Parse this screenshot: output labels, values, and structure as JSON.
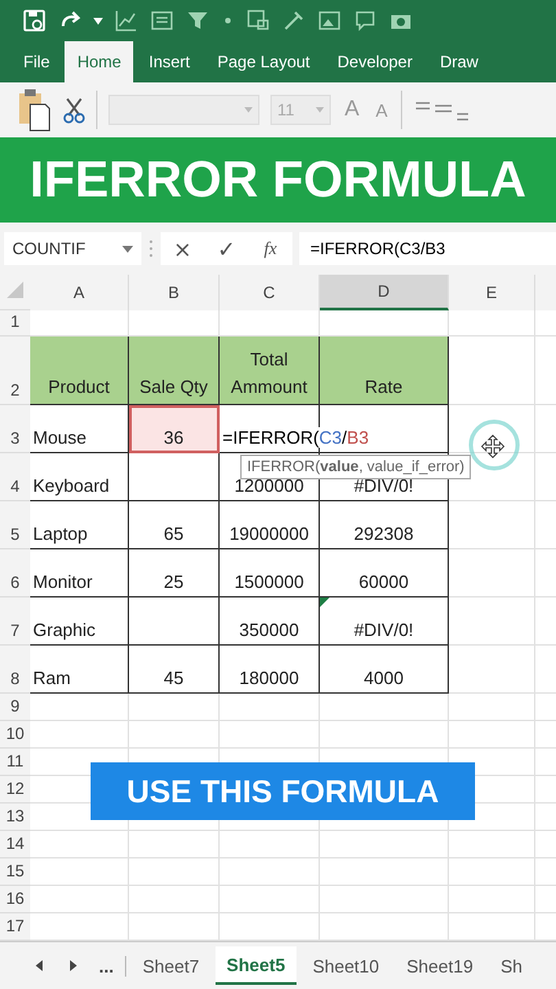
{
  "ribbon_tabs": [
    {
      "label": "File",
      "selected": false
    },
    {
      "label": "Home",
      "selected": true
    },
    {
      "label": "Insert",
      "selected": false
    },
    {
      "label": "Page Layout",
      "selected": false
    },
    {
      "label": "Developer",
      "selected": false
    },
    {
      "label": "Draw",
      "selected": false
    }
  ],
  "ribbon": {
    "font_size": "11",
    "grow_font": "A",
    "shrink_font": "A"
  },
  "banner": {
    "title": "IFERROR FORMULA"
  },
  "formula_bar": {
    "name_box": "COUNTIF",
    "cancel": "×",
    "enter": "✓",
    "function": "fx",
    "formula": "=IFERROR(C3/B3"
  },
  "columns": [
    {
      "label": "A",
      "selected": false
    },
    {
      "label": "B",
      "selected": false
    },
    {
      "label": "C",
      "selected": false
    },
    {
      "label": "D",
      "selected": true
    },
    {
      "label": "E",
      "selected": false
    }
  ],
  "row_numbers": [
    "1",
    "2",
    "3",
    "4",
    "5",
    "6",
    "7",
    "8",
    "9",
    "10",
    "11",
    "12",
    "13",
    "14",
    "15",
    "16",
    "17"
  ],
  "table": {
    "header": [
      "Product",
      "Sale Qty",
      "Total Ammount",
      "Rate"
    ],
    "rows": [
      {
        "product": "Mouse",
        "qty": "36",
        "qty_referenced": true,
        "error_flag": false,
        "formula_parts": [
          {
            "text": "=IFERROR(",
            "color": "#000000"
          },
          {
            "text": "C3",
            "color": "#4472c4"
          },
          {
            "text": "/",
            "color": "#000000"
          },
          {
            "text": "B3",
            "color": "#c0504d"
          }
        ]
      },
      {
        "product": "Keyboard",
        "qty_referenced": false,
        "error_flag": false,
        "total": "1200000",
        "rate": "#DIV/0!"
      },
      {
        "product": "Laptop",
        "qty": "65",
        "qty_referenced": false,
        "error_flag": false,
        "total": "19000000",
        "rate": "292308"
      },
      {
        "product": "Monitor",
        "qty": "25",
        "qty_referenced": false,
        "error_flag": false,
        "total": "1500000",
        "rate": "60000"
      },
      {
        "product": "Graphic",
        "qty_referenced": false,
        "error_flag": true,
        "total": "350000",
        "rate": "#DIV/0!"
      },
      {
        "product": "Ram",
        "qty": "45",
        "qty_referenced": false,
        "error_flag": false,
        "total": "180000",
        "rate": "4000"
      }
    ]
  },
  "tooltip": "IFERROR(**value**, value_if_error)",
  "callout": "USE THIS FORMULA",
  "sheet_nav": {
    "more": "..."
  },
  "sheet_tabs": [
    {
      "label": "Sheet7",
      "selected": false
    },
    {
      "label": "Sheet5",
      "selected": true
    },
    {
      "label": "Sheet10",
      "selected": false
    },
    {
      "label": "Sheet19",
      "selected": false
    },
    {
      "label": "Sh",
      "selected": false
    }
  ]
}
